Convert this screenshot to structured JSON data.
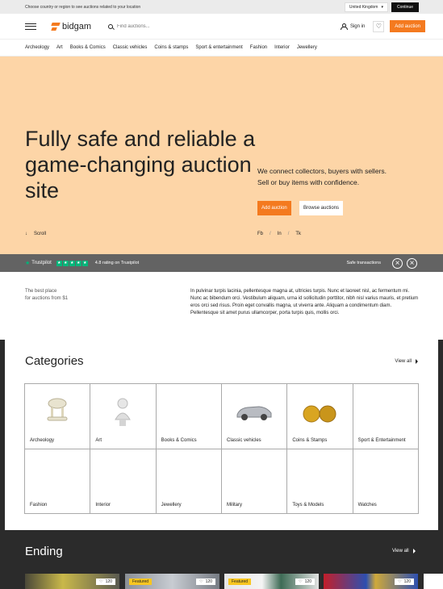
{
  "topbar": {
    "message": "Choose country or region to see auctions related to your location",
    "country": "United Kingdom",
    "continue": "Continue"
  },
  "header": {
    "logo": "bidgam",
    "search_placeholder": "Find auctions...",
    "sign_in": "Sign in",
    "add_auction": "Add auction"
  },
  "nav": [
    "Archeology",
    "Art",
    "Books & Comics",
    "Classic vehicles",
    "Coins & stamps",
    "Sport & entertainment",
    "Fashion",
    "Interior",
    "Jewellery"
  ],
  "hero": {
    "title": "Fully safe and reliable a game-changing auction site",
    "tagline_1": "We connect collectors, buyers with sellers.",
    "tagline_2": "Sell or buy items with confidence.",
    "add_auction": "Add auction",
    "browse": "Browse auctions",
    "scroll": "Scroll",
    "socials": [
      "Fb",
      "In",
      "Tk"
    ],
    "bg": "#fdd5a7",
    "accent": "#f47a1f"
  },
  "trust": {
    "logo": "Trustpilot",
    "rating": "4.8 rating on Trustpilot",
    "safe": "Safe transactions"
  },
  "intro": {
    "left_1": "The best place",
    "left_2": "for auctions from $1",
    "body": "In pulvinar turpis lacinia, pellentesque magna at, ultricies turpis. Nunc et laoreet nisl, ac fermentum mi. Nunc ac bibendum orci. Vestibulum aliquam, urna id sollicitudin porttitor, nibh nisl varius mauris, et pretium eros orci sed risus. Proin eget convallis magna, ut viverra ante. Aliquam a condimentum diam. Pellentesque sit amet purus ullamcorper, porta turpis quis, mollis orci."
  },
  "categories": {
    "title": "Categories",
    "view_all": "View all",
    "items": [
      "Archeology",
      "Art",
      "Books & Comics",
      "Classic vehicles",
      "Coins & Stamps",
      "Sport & Entertainment",
      "Fashion",
      "Interior",
      "Jewellery",
      "Military",
      "Toys & Models",
      "Watches"
    ]
  },
  "ending": {
    "title": "Ending",
    "view_all": "View all",
    "cards": [
      {
        "badge": "",
        "likes": "120"
      },
      {
        "badge": "Featured",
        "likes": "120"
      },
      {
        "badge": "Featured",
        "likes": "120"
      },
      {
        "badge": "",
        "likes": "120"
      }
    ]
  }
}
